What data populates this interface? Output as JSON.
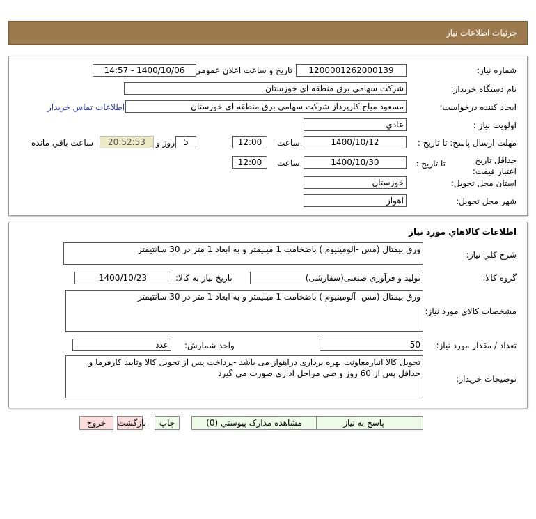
{
  "header": {
    "title": "جزئیات اطلاعات نیاز"
  },
  "need": {
    "number_label": "شماره نیاز:",
    "number": "1200001262000139",
    "announce_label": "تاریخ و ساعت اعلان عمومي:",
    "announce": "1400/10/06 - 14:57",
    "buyer_label": "نام دستگاه خريدار:",
    "buyer": "شرکت سهامی برق منطقه ای خوزستان",
    "creator_label": "ايجاد کننده درخواست:",
    "creator": "مسعود میاح کارپرداز شرکت سهامی برق منطقه ای خوزستان",
    "contact_link": "اطلاعات تماس خريدار",
    "priority_label": "اولويت نياز :",
    "priority": "عادي",
    "deadline_label": "مهلت ارسال پاسخ: تا تاريخ :",
    "deadline_date": "1400/10/12",
    "time_label": "ساعت",
    "deadline_time": "12:00",
    "days": "5",
    "days_label": "روز و",
    "remaining": "20:52:53",
    "remaining_label": "ساعت باقي مانده",
    "validity_label": "حداقل تاريخ اعتبار قيمت:",
    "validity_to": "تا تاريخ :",
    "validity_date": "1400/10/30",
    "validity_time": "12:00",
    "province_label": "استان محل تحويل:",
    "province": "خوزستان",
    "city_label": "شهر محل تحويل:",
    "city": "اهواز"
  },
  "goods": {
    "title": "اطلاعات کالاهاي مورد نياز",
    "summary_label": "شرح کلي نياز:",
    "summary": "ورق بیمتال (مس -آلومینیوم ) باضخامت 1 میلیمتر و به ابعاد 1 متر در 30 سانتیمتر",
    "group_label": "گروه کالا:",
    "group": "تولید و فرآوری صنعتی(سفارشی)",
    "need_date_label": "تاريخ نياز به کالا:",
    "need_date": "1400/10/23",
    "spec_label": "مشخصات کالاي مورد نياز:",
    "spec": "ورق بیمتال (مس -آلومینیوم ) باضخامت 1 میلیمتر و به ابعاد 1 متر در 30 سانتیمتر",
    "qty_label": "تعداد / مقدار مورد نياز:",
    "qty": "50",
    "unit_label": "واحد شمارش:",
    "unit": "عدد",
    "desc_label": "توضيحات خريدار:",
    "desc": "تحویل کالا انبارمعاونت بهره برداری دراهواز می باشد -پرداخت پس از تحویل کالا وتایید کارفرما و حداقل پس از 60 روز و طی مراحل اداری صورت می گیرد"
  },
  "buttons": {
    "reply": "پاسخ به نياز",
    "docs": "مشاهده مدارک پيوستي (0)",
    "print": "چاپ",
    "back": "بازگشت",
    "exit": "خروج"
  }
}
